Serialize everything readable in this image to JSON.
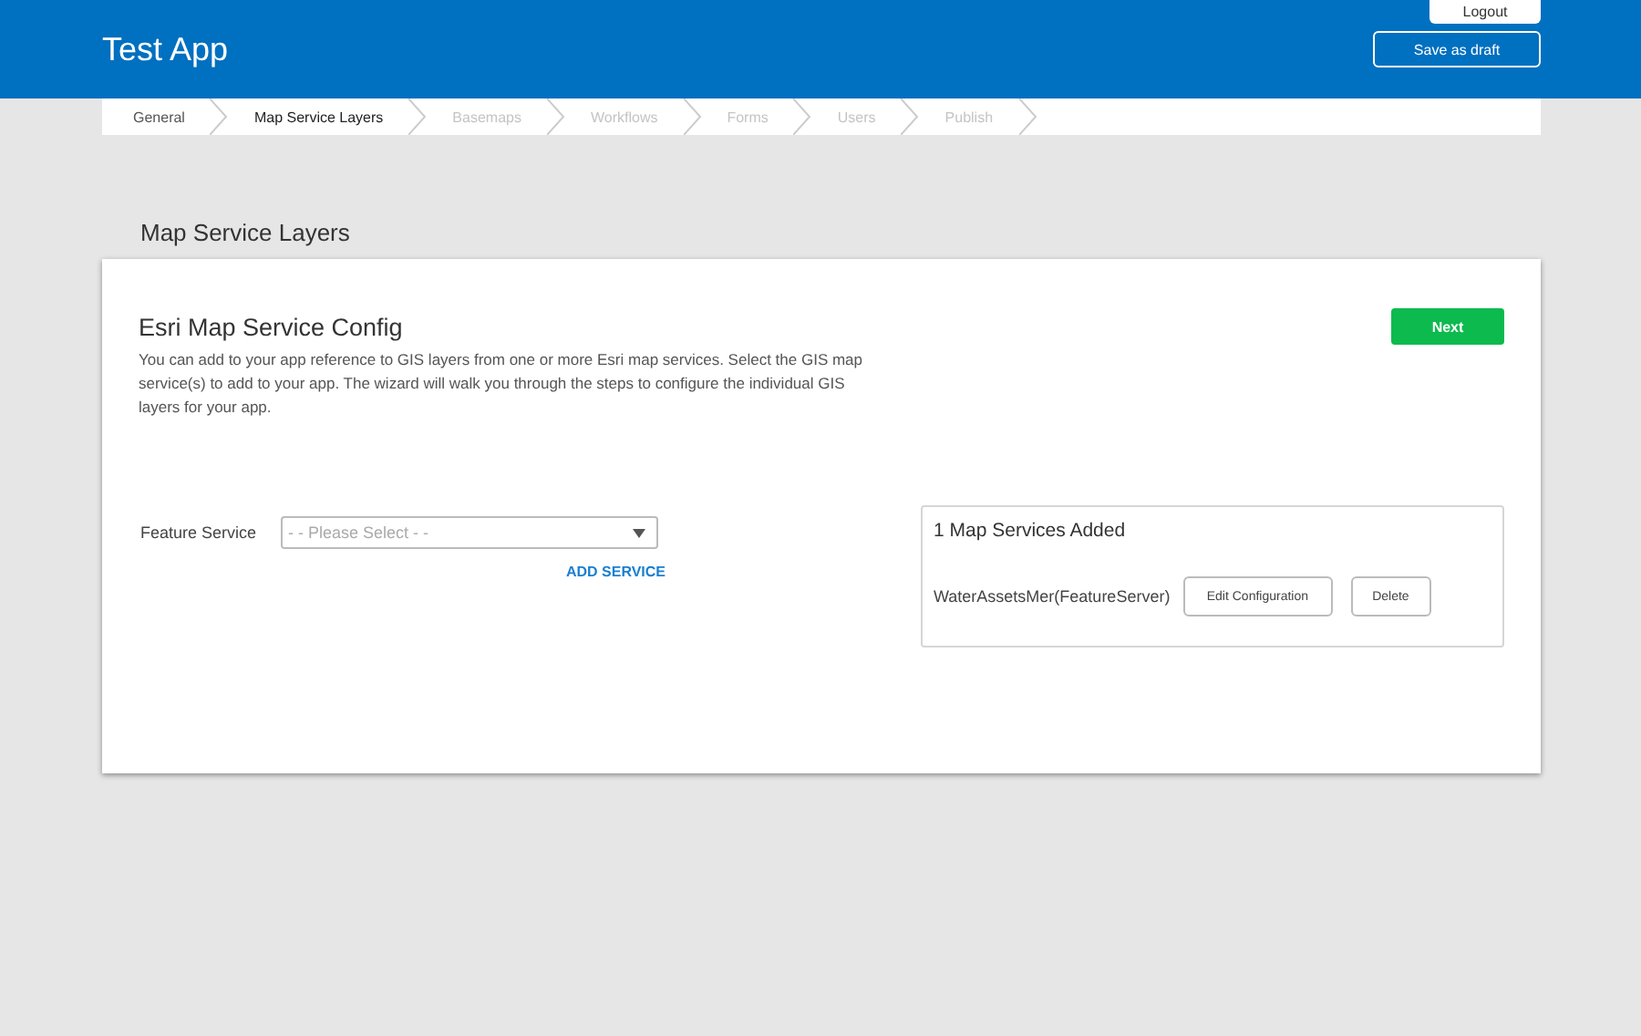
{
  "header": {
    "title": "Test App",
    "logout_button": "Logout",
    "save_button": "Save as draft"
  },
  "steps": [
    {
      "label": "General",
      "selected": false,
      "disabled": false
    },
    {
      "label": "Map Service Layers",
      "selected": true,
      "disabled": false
    },
    {
      "label": "Basemaps",
      "selected": false,
      "disabled": true
    },
    {
      "label": "Workflows",
      "selected": false,
      "disabled": true
    },
    {
      "label": "Forms",
      "selected": false,
      "disabled": true
    },
    {
      "label": "Users",
      "selected": false,
      "disabled": true
    },
    {
      "label": "Publish",
      "selected": false,
      "disabled": true
    }
  ],
  "section_title": "Map Service Layers",
  "card": {
    "title": "Esri Map Service Config",
    "description": "You can add to your app reference to GIS layers from one or more Esri map services. Select the GIS map service(s) to add to your app. The wizard will walk you through the steps to configure the individual GIS layers for your app.",
    "next_button": "Next",
    "form": {
      "label": "Feature Service",
      "placeholder": "- - Please Select - -",
      "add_link": "ADD SERVICE"
    },
    "added": {
      "title": "1 Map Services Added",
      "services": [
        {
          "name": "WaterAssetsMer(FeatureServer)",
          "edit_button": "Edit Configuration",
          "delete_button": "Delete"
        }
      ]
    }
  }
}
